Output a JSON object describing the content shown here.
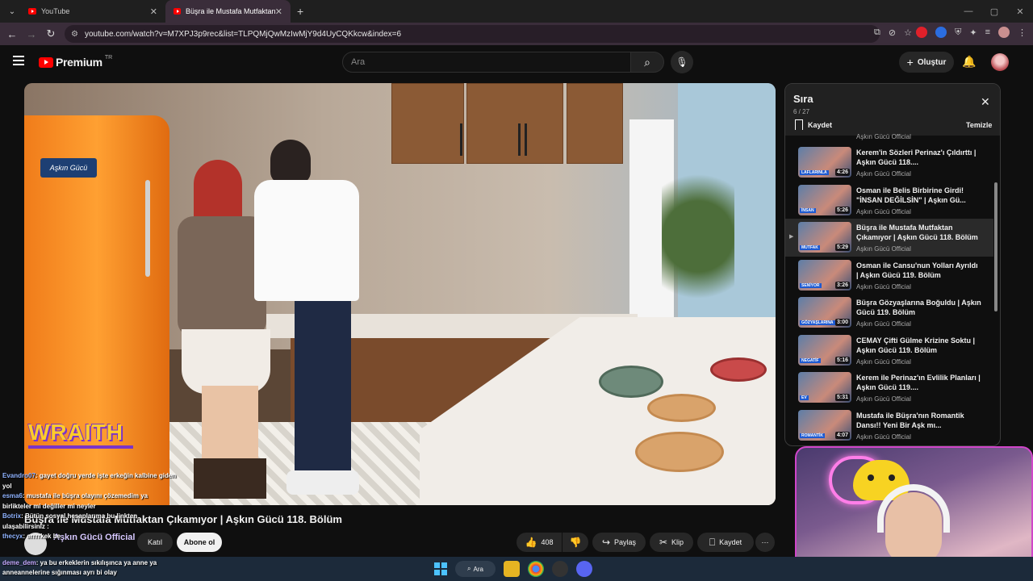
{
  "browser": {
    "tabs": [
      {
        "title": "YouTube",
        "close": "✕"
      },
      {
        "title": "Büşra ile Mustafa Mutfaktan Çı",
        "close": "✕"
      }
    ],
    "new_tab": "+",
    "window_controls": {
      "minimize": "—",
      "maximize": "▢",
      "close": "✕"
    },
    "url": "youtube.com/watch?v=M7XPJ3p9rec&list=TLPQMjQwMzIwMjY9d4UyCQKkcw&index=6"
  },
  "yt": {
    "logo_text": "Premium",
    "logo_region": "TR",
    "search_placeholder": "Ara",
    "create_label": "Oluştur"
  },
  "video": {
    "studio_logo": "Aşkın Gücü",
    "overlay_brand": "WRAITH",
    "title": "Büşra ile Mustafa Mutfaktan Çıkamıyor | Aşkın Gücü 118. Bölüm",
    "channel": "Aşkın Gücü Official",
    "join_label": "Katıl",
    "subscribe_label": "Abone ol",
    "likes": "408",
    "share_label": "Paylaş",
    "clip_label": "Klip",
    "save_label": "Kaydet",
    "more": "⋯"
  },
  "queue": {
    "title": "Sıra",
    "position": "6 / 27",
    "save_label": "Kaydet",
    "clear_label": "Temizle",
    "prev_channel": "Aşkın Gücü Official",
    "items": [
      {
        "title": "Kerem'in Sözleri Perinaz'ı Çıldırttı | Aşkın Gücü 118....",
        "channel": "Aşkın Gücü Official",
        "duration": "4:26",
        "caption": "LAFLARINLA",
        "current": false
      },
      {
        "title": "Osman ile Belis Birbirine Girdi! \"İNSAN DEĞİLSİN\" | Aşkın Gü...",
        "channel": "Aşkın Gücü Official",
        "duration": "5:26",
        "caption": "İNSAN",
        "current": false
      },
      {
        "title": "Büşra ile Mustafa Mutfaktan Çıkamıyor | Aşkın Gücü 118. Bölüm",
        "channel": "Aşkın Gücü Official",
        "duration": "5:29",
        "caption": "MUTFAK",
        "current": true
      },
      {
        "title": "Osman ile Cansu'nun Yolları Ayrıldı | Aşkın Gücü 119. Bölüm",
        "channel": "Aşkın Gücü Official",
        "duration": "3:26",
        "caption": "SENİYOR",
        "current": false
      },
      {
        "title": "Büşra Gözyaşlarına Boğuldu | Aşkın Gücü 119. Bölüm",
        "channel": "Aşkın Gücü Official",
        "duration": "3:00",
        "caption": "GÖZYAŞLARINA",
        "current": false
      },
      {
        "title": "CEMAY Çifti Gülme Krizine Soktu | Aşkın Gücü 119. Bölüm",
        "channel": "Aşkın Gücü Official",
        "duration": "5:16",
        "caption": "NEGATİF",
        "current": false
      },
      {
        "title": "Kerem ile Perinaz'ın Evlilik Planları | Aşkın Gücü 119....",
        "channel": "Aşkın Gücü Official",
        "duration": "5:31",
        "caption": "EV",
        "current": false
      },
      {
        "title": "Mustafa ile Büşra'nın Romantik Dansı!! Yeni Bir Aşk mı...",
        "channel": "Aşkın Gücü Official",
        "duration": "4:07",
        "caption": "ROMANTİK",
        "current": false
      }
    ]
  },
  "chat": [
    {
      "user": "Evandro07",
      "msg": ": gayet doğru yerde işte erkeğin kalbine giden yol"
    },
    {
      "user": "esma6",
      "msg": ": mustafa ile büşra olayını çözemedim ya birlikteler mi değiller mi neyler"
    },
    {
      "user": "Botrix",
      "msg": ": Bütün sosyal hesaplarıma bu linkten ulaşabilirsiniz :"
    },
    {
      "user": "thecyx",
      "msg": ": errrrkek be"
    },
    {
      "user": "deme_dem",
      "msg": ": ya bu erkeklerin sıkılışınca ya anne ya anneannelerine sığınması ayrı bi olay"
    }
  ],
  "taskbar": {
    "search_label": "Ara"
  }
}
